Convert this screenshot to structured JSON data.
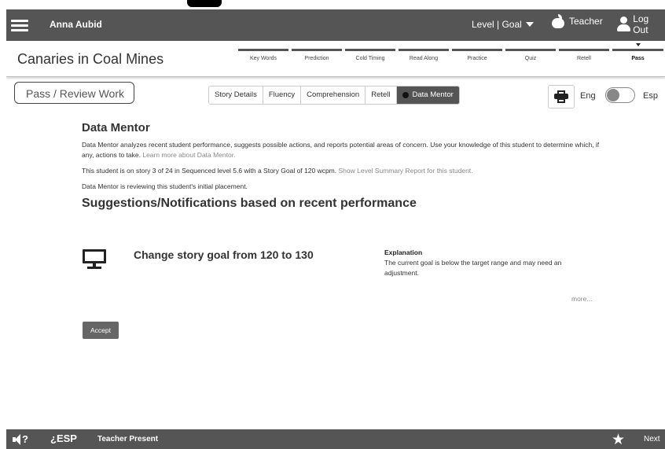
{
  "header": {
    "user_name": "Anna Aubid",
    "level_goal": "Level | Goal",
    "teacher_label": "Teacher",
    "logout_label": "Log Out"
  },
  "story": {
    "title": "Canaries in Coal Mines",
    "steps": [
      {
        "label": "Key Words",
        "active": false
      },
      {
        "label": "Prediction",
        "active": false
      },
      {
        "label": "Cold Timing",
        "active": false
      },
      {
        "label": "Read Along",
        "active": false
      },
      {
        "label": "Practice",
        "active": false
      },
      {
        "label": "Quiz",
        "active": false
      },
      {
        "label": "Retell",
        "active": false
      },
      {
        "label": "Pass",
        "active": true
      }
    ]
  },
  "subheader": {
    "section_title": "Pass / Review Work",
    "tabs": [
      {
        "label": "Story Details",
        "active": false
      },
      {
        "label": "Fluency",
        "active": false
      },
      {
        "label": "Comprehension",
        "active": false
      },
      {
        "label": "Retell",
        "active": false
      },
      {
        "label": "Data Mentor",
        "active": true
      }
    ],
    "lang_eng": "Eng",
    "lang_esp": "Esp"
  },
  "content": {
    "heading": "Data Mentor",
    "intro_text": "Data Mentor analyzes recent student performance, suggests possible actions, and reports potential areas of concern. Use your knowledge of this student to determine which, if any, actions to take.",
    "intro_link": "Learn more about Data Mentor.",
    "story_status": "This student is on story 3 of 24 in Sequenced level 5.6 with a Story Goal of 120 wcpm.",
    "story_status_link": "Show Level Summary Report for this student.",
    "review_note": "Data Mentor is reviewing this student's initial placement.",
    "suggestions_heading": "Suggestions/Notifications based on recent performance",
    "suggestion_title": "Change story goal from 120 to 130",
    "explanation_title": "Explanation",
    "explanation_text": "The current goal is below the target range and may need an adjustment.",
    "more_label": "more...",
    "accept_label": "Accept"
  },
  "footer": {
    "esp_label": "¿ESP",
    "teacher_present": "Teacher Present",
    "next_label": "Next"
  }
}
